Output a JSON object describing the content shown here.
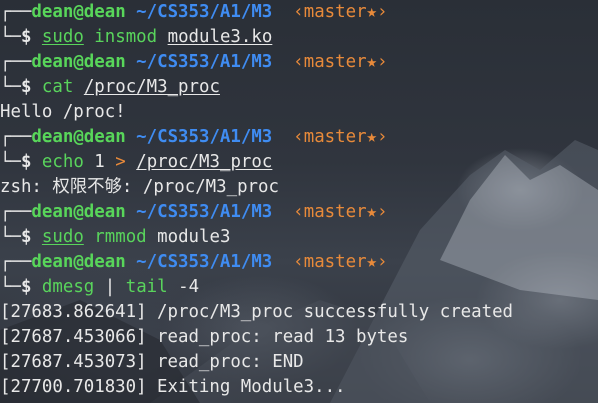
{
  "prompt": {
    "user": "dean",
    "at": "@",
    "host": "dean",
    "cwd": "~/CS353/A1/M3",
    "branch": "‹master★›",
    "top_corner": "┌──",
    "bottom_corner": "└─",
    "dollar": "$"
  },
  "blocks": [
    {
      "cmd": {
        "tool": "sudo",
        "args": [
          {
            "text": "insmod",
            "style": "ok"
          },
          {
            "text": "module3.ko",
            "style": "ul"
          }
        ]
      },
      "output": []
    },
    {
      "cmd": {
        "tool": "cat",
        "args": [
          {
            "text": "/proc/M3_proc",
            "style": "ul"
          }
        ]
      },
      "output": [
        "Hello /proc!"
      ]
    },
    {
      "cmd": {
        "tool": "echo",
        "args": [
          {
            "text": "1",
            "style": "arg"
          },
          {
            "text": ">",
            "style": "op"
          },
          {
            "text": "/proc/M3_proc",
            "style": "ul"
          }
        ]
      },
      "output": [
        "zsh: 权限不够: /proc/M3_proc"
      ]
    },
    {
      "cmd": {
        "tool": "sudo",
        "args": [
          {
            "text": "rmmod",
            "style": "ok"
          },
          {
            "text": "module3",
            "style": "arg"
          }
        ]
      },
      "output": []
    },
    {
      "cmd": {
        "tool": "dmesg",
        "args": [
          {
            "text": "|",
            "style": "arg"
          },
          {
            "text": "tail",
            "style": "ok"
          },
          {
            "text": "-4",
            "style": "arg"
          }
        ]
      },
      "output": [
        "[27683.862641] /proc/M3_proc successfully created",
        "[27687.453066] read_proc: read 13 bytes",
        "[27687.453073] read_proc: END",
        "[27700.701830] Exiting Module3..."
      ]
    }
  ],
  "colors": {
    "user": "#58d65a",
    "path": "#3f8cf2",
    "branch": "#e88a3a",
    "command_ok": "#59d45c",
    "text": "#e8e8e8"
  }
}
